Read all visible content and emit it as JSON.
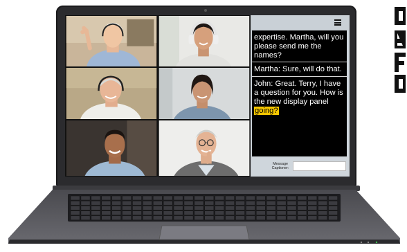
{
  "captions": [
    {
      "segments": [
        {
          "text": "expertise.  Martha, will you please send me the names?",
          "highlight": false
        }
      ]
    },
    {
      "segments": [
        {
          "text": "Martha:  Sure, will do that.",
          "highlight": false
        }
      ]
    },
    {
      "segments": [
        {
          "text": "John:  Great.  Terry, I have a question for you. How is the new display panel ",
          "highlight": false
        },
        {
          "text": "going?",
          "highlight": true
        }
      ]
    }
  ],
  "message_captioner_label": "Message Captioner:",
  "colors": {
    "highlight": "#f6c700",
    "panel_bg": "#cfd6dc",
    "caption_bg": "#000000"
  },
  "participants": [
    "participant-1",
    "participant-2",
    "participant-3",
    "participant-4",
    "participant-5",
    "participant-6"
  ]
}
